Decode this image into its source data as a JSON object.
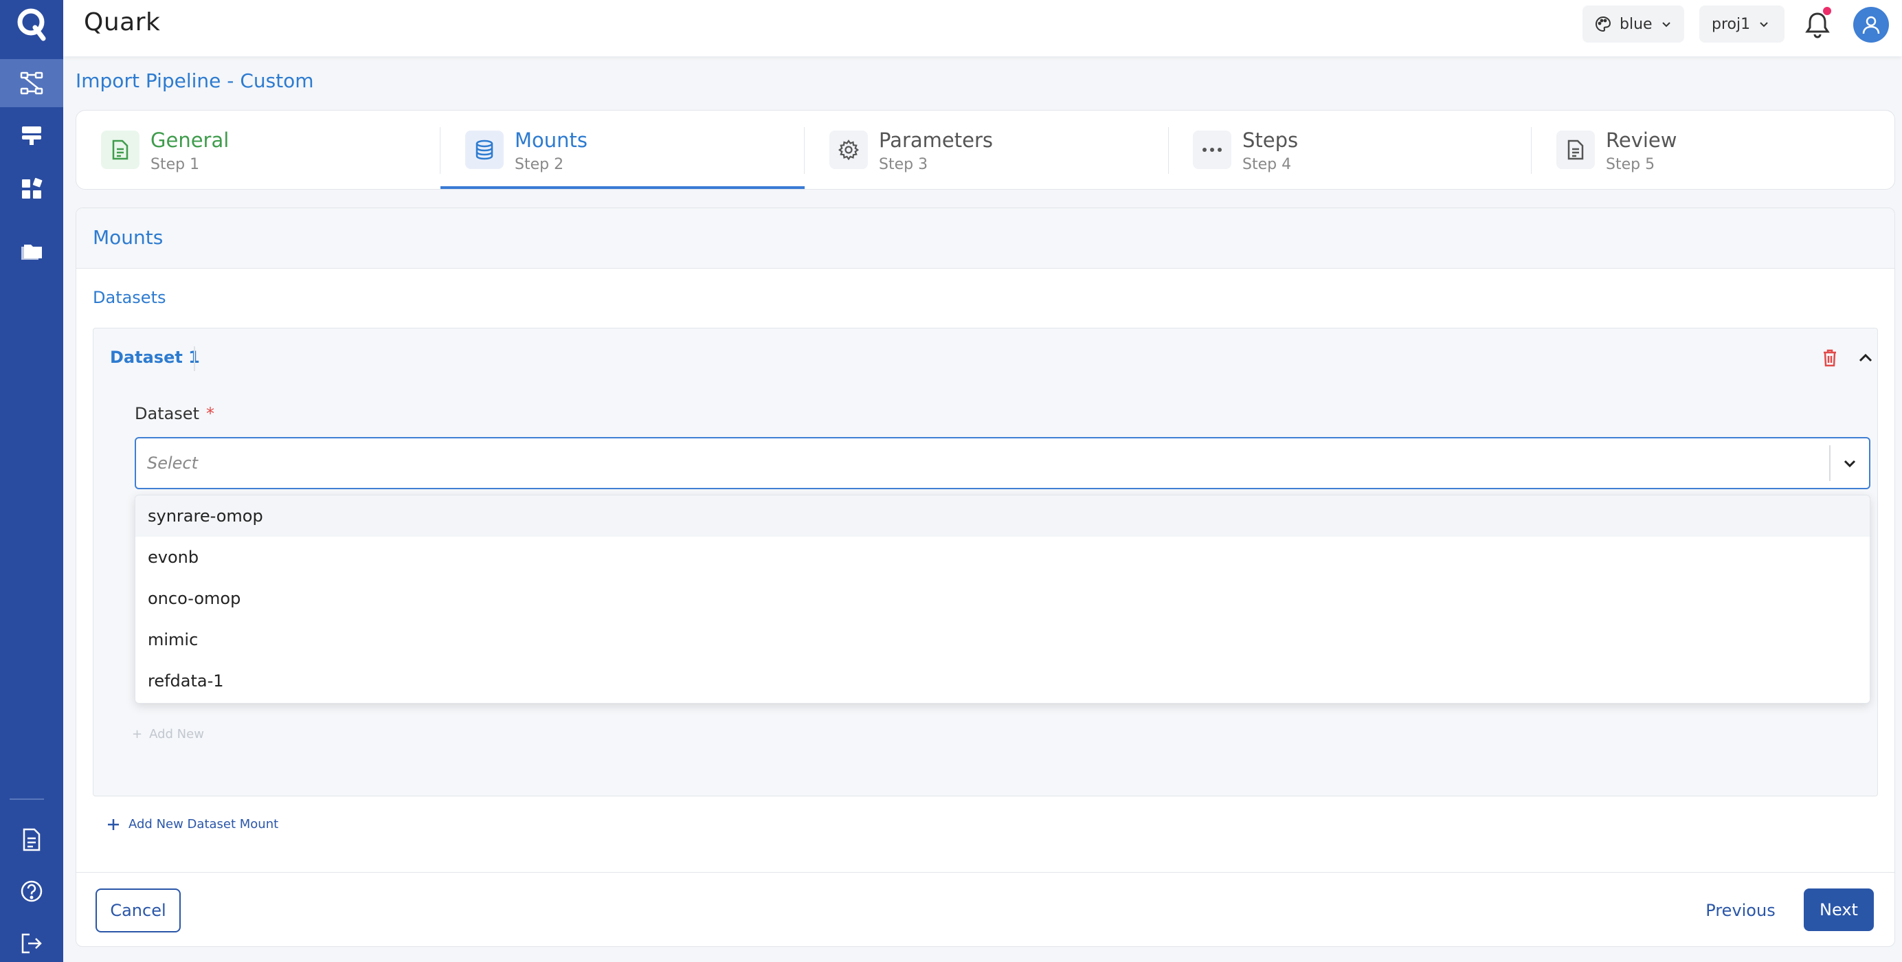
{
  "app": {
    "title": "Quark"
  },
  "topbar": {
    "theme_label": "blue",
    "project_label": "proj1"
  },
  "sidebar": {
    "items": [
      {
        "icon": "pipeline-icon",
        "active": true
      },
      {
        "icon": "server-icon",
        "active": false
      },
      {
        "icon": "apps-icon",
        "active": false
      },
      {
        "icon": "folders-icon",
        "active": false
      }
    ],
    "bottom_items": [
      {
        "icon": "document-icon"
      },
      {
        "icon": "help-icon"
      },
      {
        "icon": "logout-icon"
      }
    ]
  },
  "breadcrumb": "Import Pipeline - Custom",
  "steps": [
    {
      "title": "General",
      "sub": "Step 1",
      "state": "done",
      "icon": "document-icon"
    },
    {
      "title": "Mounts",
      "sub": "Step 2",
      "state": "active",
      "icon": "database-icon"
    },
    {
      "title": "Parameters",
      "sub": "Step 3",
      "state": "pending",
      "icon": "gear-icon"
    },
    {
      "title": "Steps",
      "sub": "Step 4",
      "state": "pending",
      "icon": "ellipsis-icon"
    },
    {
      "title": "Review",
      "sub": "Step 5",
      "state": "pending",
      "icon": "document-icon"
    }
  ],
  "card": {
    "title": "Mounts",
    "datasets_label": "Datasets",
    "dataset": {
      "title": "Dataset 1",
      "field_label": "Dataset",
      "required_mark": "*",
      "placeholder": "Select",
      "options": [
        "synrare-omop",
        "evonb",
        "onco-omop",
        "mimic",
        "refdata-1"
      ],
      "highlighted_option": "synrare-omop",
      "add_new_label": "Add New"
    },
    "add_mount_label": "Add New Dataset Mount"
  },
  "footer": {
    "cancel_label": "Cancel",
    "previous_label": "Previous",
    "next_label": "Next"
  },
  "colors": {
    "sidebar": "#2a4ca0",
    "accent": "#2d7bd0",
    "primary_button": "#2a56a8",
    "done": "#3f9c4c",
    "danger": "#e24a4a",
    "notification_dot": "#ec2d6a"
  }
}
